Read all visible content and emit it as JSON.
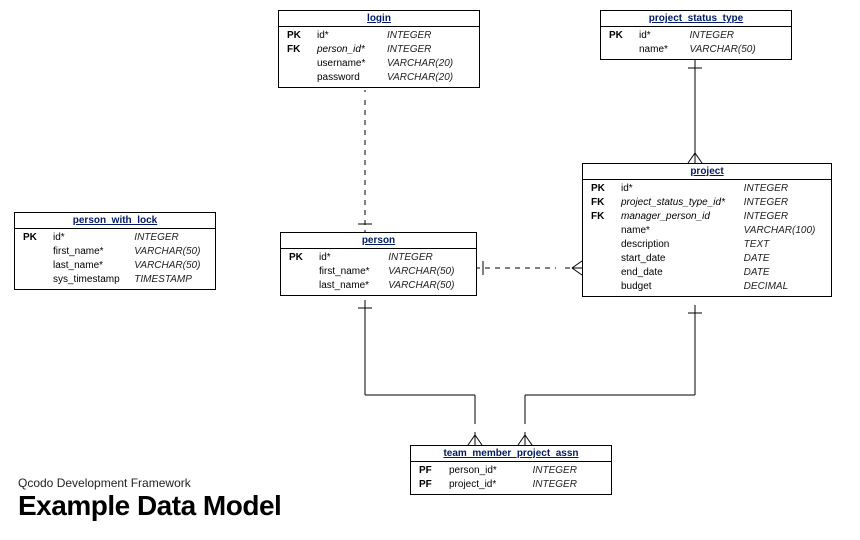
{
  "caption_small": "Qcodo Development Framework",
  "caption_big": "Example Data Model",
  "entities": {
    "login": {
      "title": "login",
      "rows": [
        {
          "key": "PK",
          "name": "id*",
          "type": "INTEGER"
        },
        {
          "key": "FK",
          "fk": true,
          "name": "person_id*",
          "type": "INTEGER"
        },
        {
          "key": "",
          "name": "username*",
          "type": "VARCHAR(20)"
        },
        {
          "key": "",
          "name": "password",
          "type": "VARCHAR(20)"
        }
      ]
    },
    "project_status_type": {
      "title": "project_status_type",
      "rows": [
        {
          "key": "PK",
          "name": "id*",
          "type": "INTEGER"
        },
        {
          "key": "",
          "name": "name*",
          "type": "VARCHAR(50)"
        }
      ]
    },
    "person_with_lock": {
      "title": "person_with_lock",
      "rows": [
        {
          "key": "PK",
          "name": "id*",
          "type": "INTEGER"
        },
        {
          "key": "",
          "name": "first_name*",
          "type": "VARCHAR(50)"
        },
        {
          "key": "",
          "name": "last_name*",
          "type": "VARCHAR(50)"
        },
        {
          "key": "",
          "name": "sys_timestamp",
          "type": "TIMESTAMP"
        }
      ]
    },
    "person": {
      "title": "person",
      "rows": [
        {
          "key": "PK",
          "name": "id*",
          "type": "INTEGER"
        },
        {
          "key": "",
          "name": "first_name*",
          "type": "VARCHAR(50)"
        },
        {
          "key": "",
          "name": "last_name*",
          "type": "VARCHAR(50)"
        }
      ]
    },
    "project": {
      "title": "project",
      "rows": [
        {
          "key": "PK",
          "name": "id*",
          "type": "INTEGER"
        },
        {
          "key": "FK",
          "fk": true,
          "name": "project_status_type_id*",
          "type": "INTEGER"
        },
        {
          "key": "FK",
          "fk": true,
          "name": "manager_person_id",
          "type": "INTEGER"
        },
        {
          "key": "",
          "name": "name*",
          "type": "VARCHAR(100)"
        },
        {
          "key": "",
          "name": "description",
          "type": "TEXT"
        },
        {
          "key": "",
          "name": "start_date",
          "type": "DATE"
        },
        {
          "key": "",
          "name": "end_date",
          "type": "DATE"
        },
        {
          "key": "",
          "name": "budget",
          "type": "DECIMAL"
        }
      ]
    },
    "team_member_project_assn": {
      "title": "team_member_project_assn",
      "rows": [
        {
          "key": "PF",
          "name": "person_id*",
          "type": "INTEGER"
        },
        {
          "key": "PF",
          "name": "project_id*",
          "type": "INTEGER"
        }
      ]
    }
  }
}
